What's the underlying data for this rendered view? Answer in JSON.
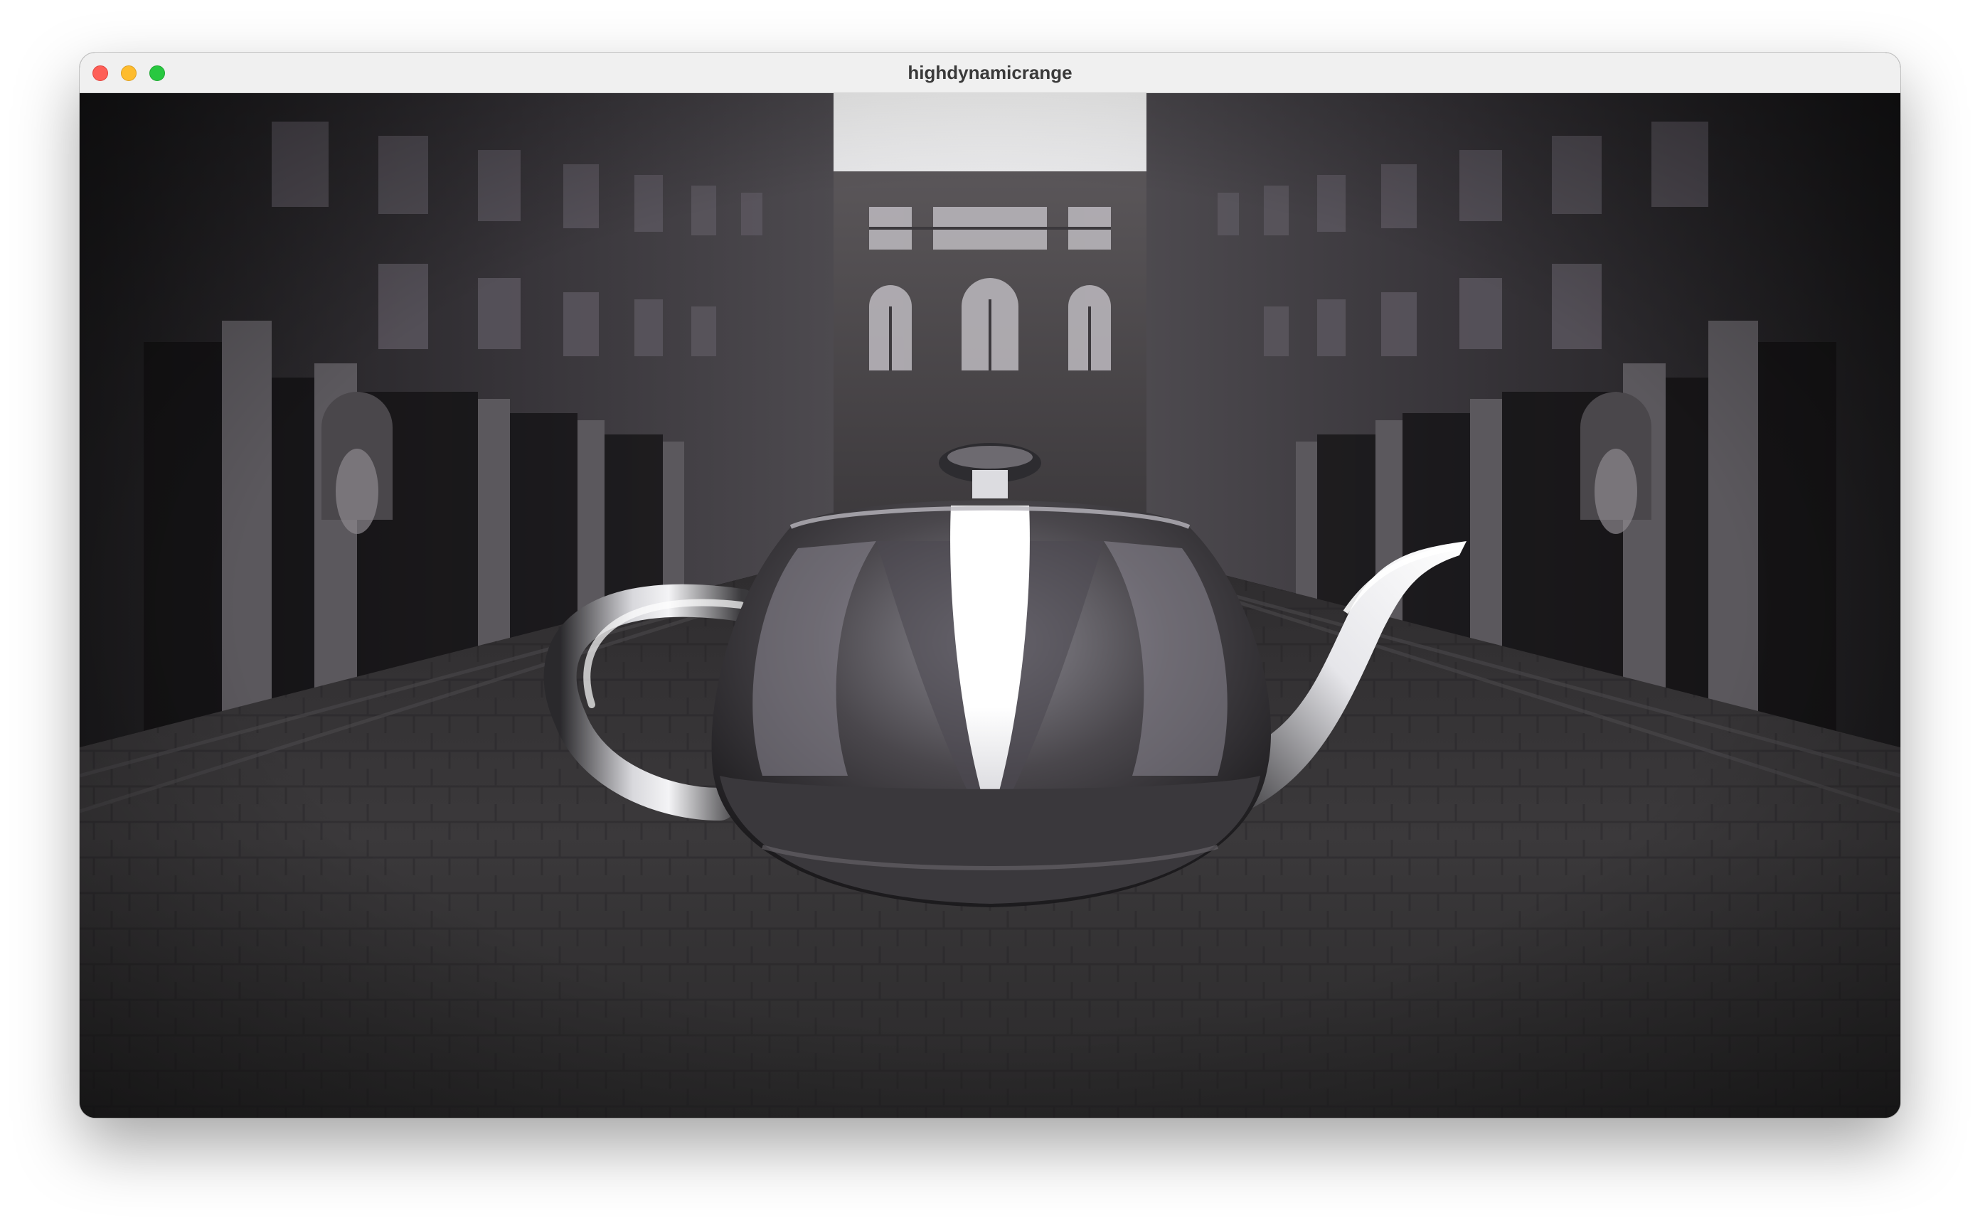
{
  "window": {
    "title": "highdynamicrange",
    "controls": {
      "close": "close-button",
      "minimize": "minimize-button",
      "maximize": "maximize-button"
    }
  },
  "scene": {
    "description_icon": "teapot-render",
    "environment": "courtyard-hdr-environment"
  }
}
